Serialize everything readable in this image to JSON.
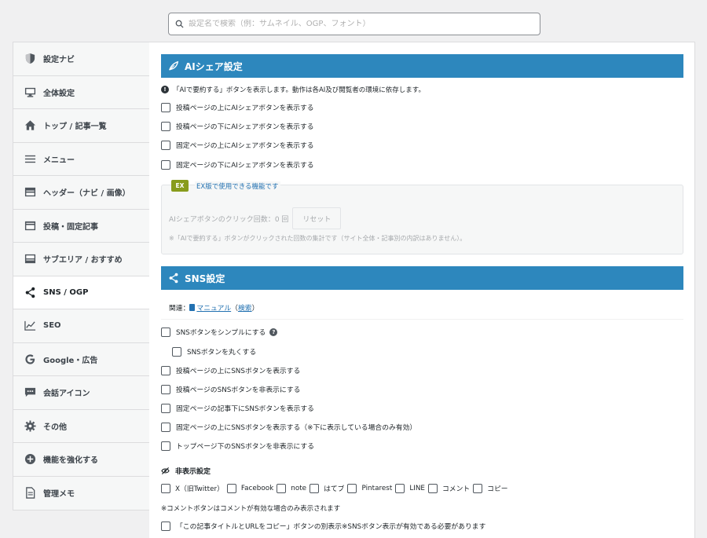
{
  "search": {
    "placeholder": "設定名で検索（例：サムネイル、OGP、フォント）"
  },
  "sidebar": {
    "items": [
      {
        "label": "設定ナビ",
        "icon": "shield-icon"
      },
      {
        "label": "全体設定",
        "icon": "monitor-icon"
      },
      {
        "label": "トップ / 記事一覧",
        "icon": "home-icon"
      },
      {
        "label": "メニュー",
        "icon": "menu-icon"
      },
      {
        "label": "ヘッダー（ナビ / 画像）",
        "icon": "header-icon"
      },
      {
        "label": "投稿・固定記事",
        "icon": "post-icon"
      },
      {
        "label": "サブエリア / おすすめ",
        "icon": "subarea-icon"
      },
      {
        "label": "SNS / OGP",
        "icon": "share-icon",
        "active": true
      },
      {
        "label": "SEO",
        "icon": "chart-icon"
      },
      {
        "label": "Google・広告",
        "icon": "google-icon"
      },
      {
        "label": "会話アイコン",
        "icon": "chat-icon"
      },
      {
        "label": "その他",
        "icon": "gear-icon"
      },
      {
        "label": "機能を強化する",
        "icon": "plus-circle-icon"
      },
      {
        "label": "管理メモ",
        "icon": "memo-icon"
      }
    ]
  },
  "ai_share": {
    "title": "AIシェア設定",
    "note": "「AIで要約する」ボタンを表示します。動作は各AI及び閲覧者の環境に依存します。",
    "options": [
      "投稿ページの上にAIシェアボタンを表示する",
      "投稿ページの下にAIシェアボタンを表示する",
      "固定ページの上にAIシェアボタンを表示する",
      "固定ページの下にAIシェアボタンを表示する"
    ],
    "ex_tag": "EX",
    "ex_text": "EX版で使用できる機能です",
    "click_count_label": "AIシェアボタンのクリック回数：",
    "click_count_value": "0 回",
    "reset_label": "リセット",
    "ex_note": "※「AIで要約する」ボタンがクリックされた回数の集計です（サイト全体・記事別の内訳はありません）。"
  },
  "sns": {
    "title": "SNS設定",
    "related_label": "関連：",
    "manual_link": "マニュアル",
    "search_link": "検索",
    "options": [
      "SNSボタンをシンプルにする",
      "SNSボタンを丸くする",
      "投稿ページの上にSNSボタンを表示する",
      "投稿ページのSNSボタンを非表示にする",
      "固定ページの記事下にSNSボタンを表示する",
      "固定ページの上にSNSボタンを表示する（※下に表示している場合のみ有効）",
      "トップページ下のSNSボタンを非表示にする"
    ],
    "hide_title": "非表示設定",
    "hide_items": [
      "X（旧Twitter）",
      "Facebook",
      "note",
      "はてブ",
      "Pintarest",
      "LINE",
      "コメント",
      "コピー"
    ],
    "comment_note": "※コメントボタンはコメントが有効な場合のみ表示されます",
    "copy_option": "「この記事タイトルとURLをコピー」ボタンの別表示※SNSボタン表示が有効である必要があります"
  },
  "colors": {
    "accent": "#2d87bd",
    "ex_tag": "#889c1c",
    "link": "#2271b1"
  }
}
